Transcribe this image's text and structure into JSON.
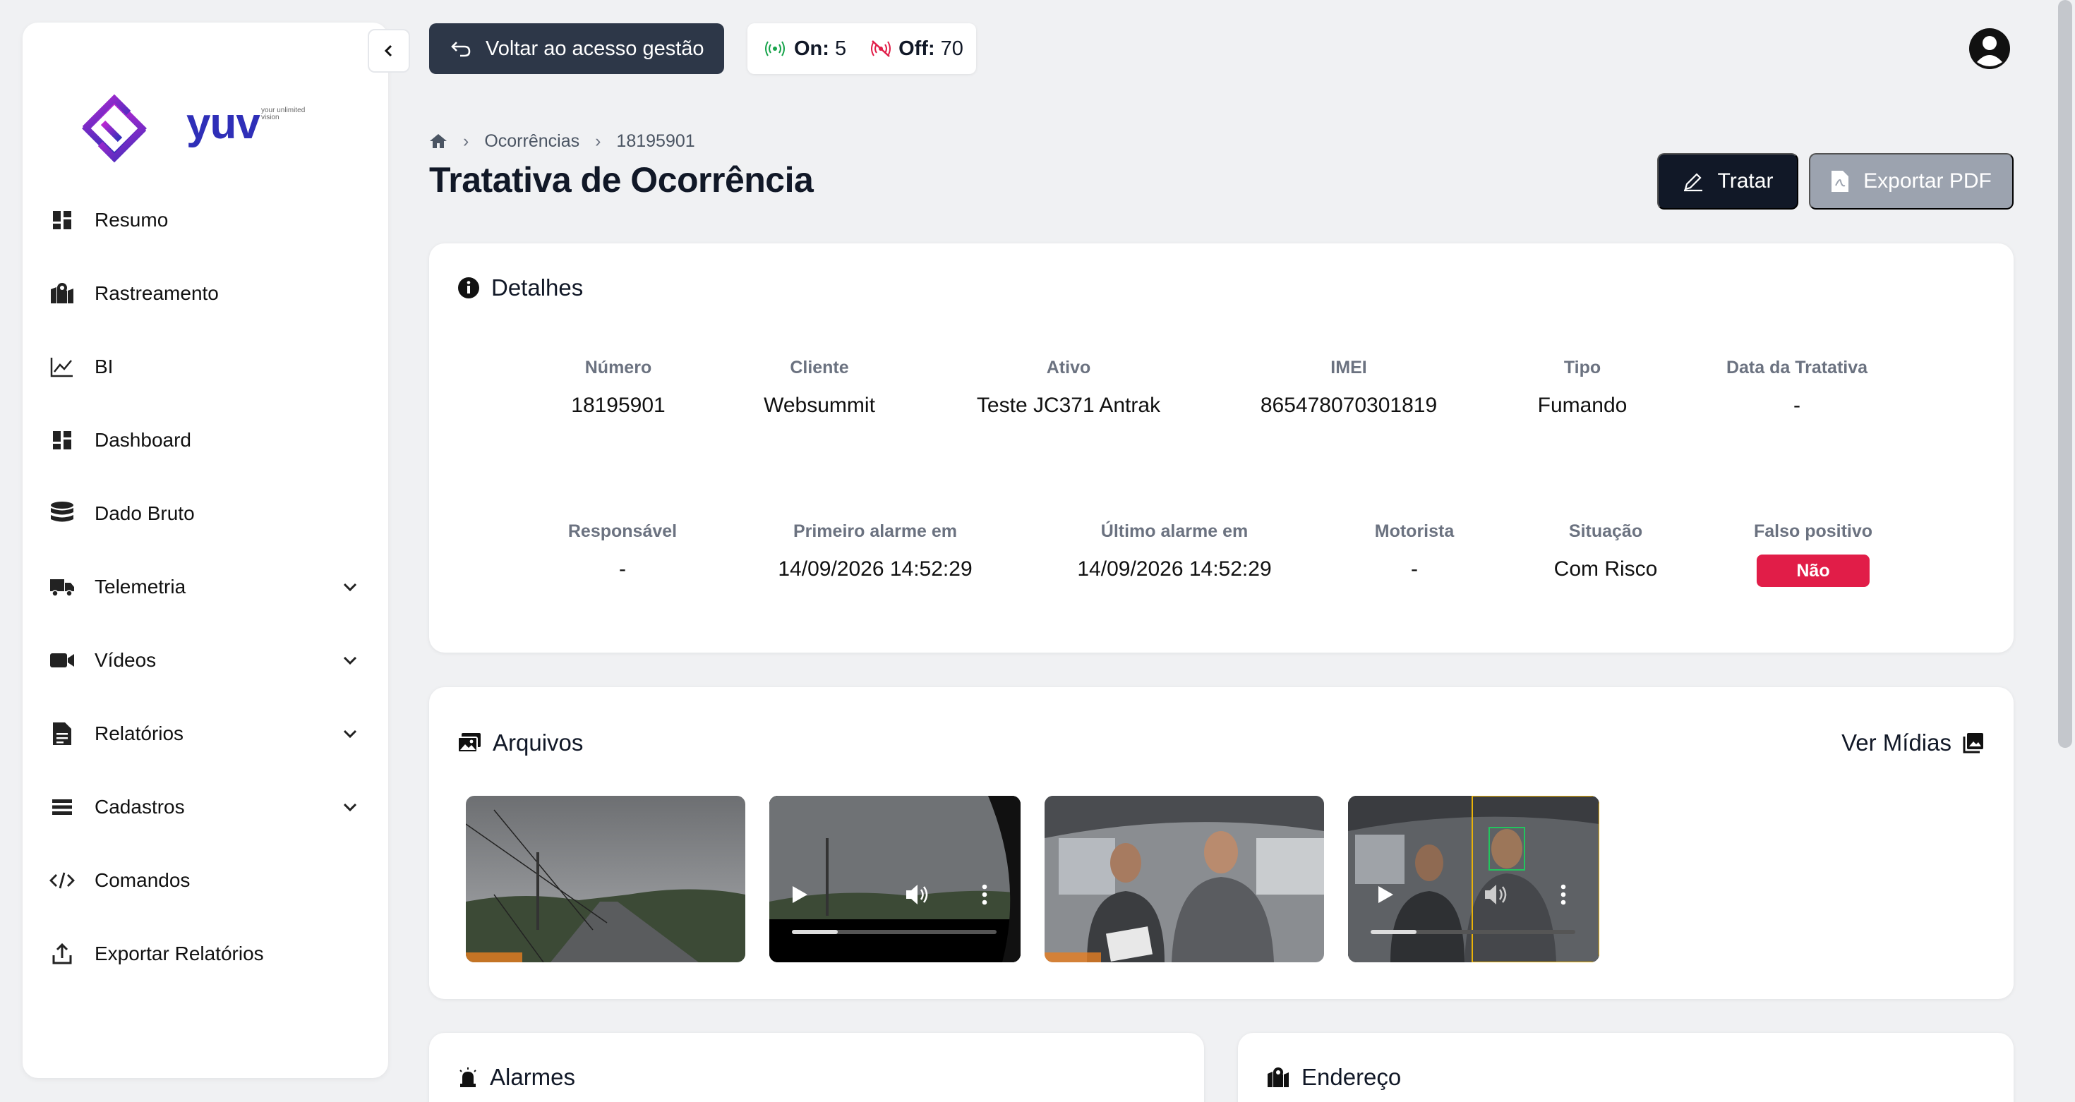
{
  "brand": {
    "name": "yuv",
    "tagline": "your unlimited vision"
  },
  "sidebar": {
    "items": [
      {
        "label": "Resumo",
        "icon": "dashboard-grid-icon",
        "expandable": false
      },
      {
        "label": "Rastreamento",
        "icon": "map-pin-icon",
        "expandable": false
      },
      {
        "label": "BI",
        "icon": "line-chart-icon",
        "expandable": false
      },
      {
        "label": "Dashboard",
        "icon": "dashboard-grid-icon",
        "expandable": false
      },
      {
        "label": "Dado Bruto",
        "icon": "database-icon",
        "expandable": false
      },
      {
        "label": "Telemetria",
        "icon": "truck-icon",
        "expandable": true
      },
      {
        "label": "Vídeos",
        "icon": "video-camera-icon",
        "expandable": true
      },
      {
        "label": "Relatórios",
        "icon": "document-icon",
        "expandable": true
      },
      {
        "label": "Cadastros",
        "icon": "list-icon",
        "expandable": true
      },
      {
        "label": "Comandos",
        "icon": "code-icon",
        "expandable": false
      },
      {
        "label": "Exportar Relatórios",
        "icon": "upload-icon",
        "expandable": false
      }
    ]
  },
  "topbar": {
    "back_label": "Voltar ao acesso gestão",
    "online_label": "On:",
    "online_count": "5",
    "offline_label": "Off:",
    "offline_count": "70"
  },
  "breadcrumb": {
    "items": [
      "Ocorrências",
      "18195901"
    ]
  },
  "page": {
    "title": "Tratativa de Ocorrência",
    "treat_label": "Tratar",
    "export_label": "Exportar PDF"
  },
  "details": {
    "title": "Detalhes",
    "row1": [
      {
        "label": "Número",
        "value": "18195901"
      },
      {
        "label": "Cliente",
        "value": "Websummit"
      },
      {
        "label": "Ativo",
        "value": "Teste JC371 Antrak"
      },
      {
        "label": "IMEI",
        "value": "865478070301819"
      },
      {
        "label": "Tipo",
        "value": "Fumando"
      },
      {
        "label": "Data da Tratativa",
        "value": "-"
      }
    ],
    "row2": [
      {
        "label": "Responsável",
        "value": "-"
      },
      {
        "label": "Primeiro alarme em",
        "value": "14/09/2026 14:52:29"
      },
      {
        "label": "Último alarme em",
        "value": "14/09/2026 14:52:29"
      },
      {
        "label": "Motorista",
        "value": "-"
      },
      {
        "label": "Situação",
        "value": "Com Risco"
      },
      {
        "label": "Falso positivo",
        "value": "Não"
      }
    ]
  },
  "files": {
    "title": "Arquivos",
    "view_media_label": "Ver Mídias",
    "thumbnails": [
      {
        "kind": "image",
        "scene": "road-rainy"
      },
      {
        "kind": "video",
        "scene": "road-rainy"
      },
      {
        "kind": "image",
        "scene": "cabin-two-people"
      },
      {
        "kind": "video",
        "scene": "cabin-two-people"
      }
    ]
  },
  "alarms": {
    "title": "Alarmes"
  },
  "address": {
    "title": "Endereço"
  },
  "colors": {
    "accent_dark": "#111827",
    "back_button": "#2d3748",
    "danger": "#e11d48",
    "online": "#16a34a",
    "offline": "#e11d48"
  }
}
